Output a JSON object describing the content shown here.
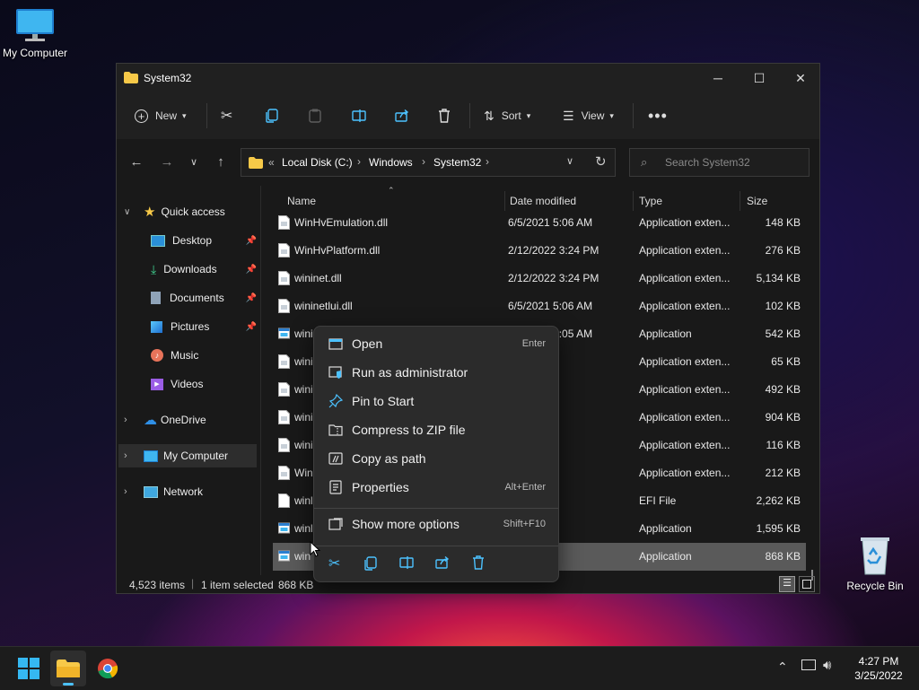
{
  "desktop": {
    "my_computer_label": "My Computer",
    "recycle_bin_label": "Recycle Bin"
  },
  "window": {
    "title": "System32",
    "toolbar": {
      "new_label": "New",
      "sort_label": "Sort",
      "view_label": "View"
    },
    "address": {
      "prefix": "«",
      "crumbs": [
        "Local Disk (C:)",
        "Windows",
        "System32"
      ]
    },
    "search_placeholder": "Search System32",
    "sidebar": {
      "quick_access": "Quick access",
      "items": [
        "Desktop",
        "Downloads",
        "Documents",
        "Pictures",
        "Music",
        "Videos"
      ],
      "onedrive": "OneDrive",
      "my_computer": "My Computer",
      "network": "Network"
    },
    "columns": [
      "Name",
      "Date modified",
      "Type",
      "Size"
    ],
    "rows": [
      {
        "name": "WinHvEmulation.dll",
        "date": "6/5/2021 5:06 AM",
        "type": "Application exten...",
        "size": "148 KB"
      },
      {
        "name": "WinHvPlatform.dll",
        "date": "2/12/2022 3:24 PM",
        "type": "Application exten...",
        "size": "276 KB"
      },
      {
        "name": "wininet.dll",
        "date": "2/12/2022 3:24 PM",
        "type": "Application exten...",
        "size": "5,134 KB"
      },
      {
        "name": "wininetlui.dll",
        "date": "6/5/2021 5:06 AM",
        "type": "Application exten...",
        "size": "102 KB"
      },
      {
        "name": "wininit.exe",
        "date": "6/5/2021 5:05 AM",
        "type": "Application",
        "size": "542 KB"
      },
      {
        "name": "wini",
        "date": "05 AM",
        "type": "Application exten...",
        "size": "65 KB"
      },
      {
        "name": "wini",
        "date": "05 AM",
        "type": "Application exten...",
        "size": "492 KB"
      },
      {
        "name": "wini",
        "date": "05 AM",
        "type": "Application exten...",
        "size": "904 KB"
      },
      {
        "name": "wini",
        "date": "05 AM",
        "type": "Application exten...",
        "size": "116 KB"
      },
      {
        "name": "Win",
        "date": "05 AM",
        "type": "Application exten...",
        "size": "212 KB"
      },
      {
        "name": "winl",
        "date": "10:36 PM",
        "type": "EFI File",
        "size": "2,262 KB"
      },
      {
        "name": "winl",
        "date": "10:36 PM",
        "type": "Application",
        "size": "1,595 KB"
      },
      {
        "name": "win",
        "date": "3:24 PM",
        "type": "Application",
        "size": "868 KB"
      }
    ],
    "status": {
      "items": "4,523 items",
      "selected": "1 item selected",
      "size": "868 KB"
    }
  },
  "context_menu": {
    "items": [
      {
        "label": "Open",
        "shortcut": "Enter"
      },
      {
        "label": "Run as administrator",
        "shortcut": ""
      },
      {
        "label": "Pin to Start",
        "shortcut": ""
      },
      {
        "label": "Compress to ZIP file",
        "shortcut": ""
      },
      {
        "label": "Copy as path",
        "shortcut": ""
      },
      {
        "label": "Properties",
        "shortcut": "Alt+Enter"
      }
    ],
    "more": {
      "label": "Show more options",
      "shortcut": "Shift+F10"
    }
  },
  "taskbar": {
    "time": "4:27 PM",
    "date": "3/25/2022"
  },
  "colors": {
    "accent": "#4cc2ff",
    "folder": "#f7c948",
    "selected_row": "#5a5a5a"
  }
}
